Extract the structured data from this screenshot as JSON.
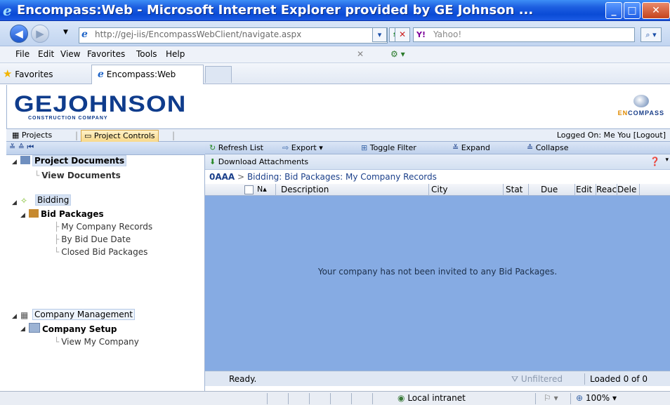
{
  "window": {
    "title": "Encompass:Web - Microsoft Internet Explorer provided by GE Johnson ..."
  },
  "address": {
    "url": "http://gej-iis/EncompassWebClient/navigate.aspx",
    "search_placeholder": "Yahoo!"
  },
  "menus": [
    "File",
    "Edit",
    "View",
    "Favorites",
    "Tools",
    "Help"
  ],
  "favorites": {
    "label": "Favorites",
    "tab_title": "Encompass:Web"
  },
  "banner": {
    "logo": "GEJOHNSON",
    "logo_sub": "CONSTRUCTION COMPANY",
    "product_en": "EN",
    "product_rest": "COMPASS"
  },
  "app_tabs": {
    "projects": "Projects",
    "project_controls": "Project Controls",
    "logged_on": "Logged On: Me You",
    "logout": "[Logout]"
  },
  "tree": {
    "project_documents": "Project Documents",
    "view_documents": "View Documents",
    "bidding": "Bidding",
    "bid_packages": "Bid Packages",
    "my_company_records": "My Company Records",
    "by_bid_due_date": "By Bid Due Date",
    "closed_bid_packages": "Closed Bid Packages",
    "company_management": "Company Management",
    "company_setup": "Company Setup",
    "view_my_company": "View My Company"
  },
  "toolbar": {
    "refresh": "Refresh List",
    "export": "Export",
    "toggle_filter": "Toggle Filter",
    "expand": "Expand",
    "collapse": "Collapse",
    "download": "Download Attachments"
  },
  "breadcrumb": {
    "project": "0AAA",
    "sep": ">",
    "path": "Bidding: Bid Packages: My Company Records"
  },
  "grid": {
    "columns": [
      "N▴",
      "Description",
      "City",
      "Stat",
      "Due",
      "Edit",
      "Reac",
      "Dele"
    ],
    "empty_message": "Your company has not been invited to any Bid Packages."
  },
  "status": {
    "ready": "Ready.",
    "filter": "Unfiltered",
    "loaded": "Loaded 0 of 0"
  },
  "ie_status": {
    "zone": "Local intranet",
    "zoom": "100%"
  }
}
